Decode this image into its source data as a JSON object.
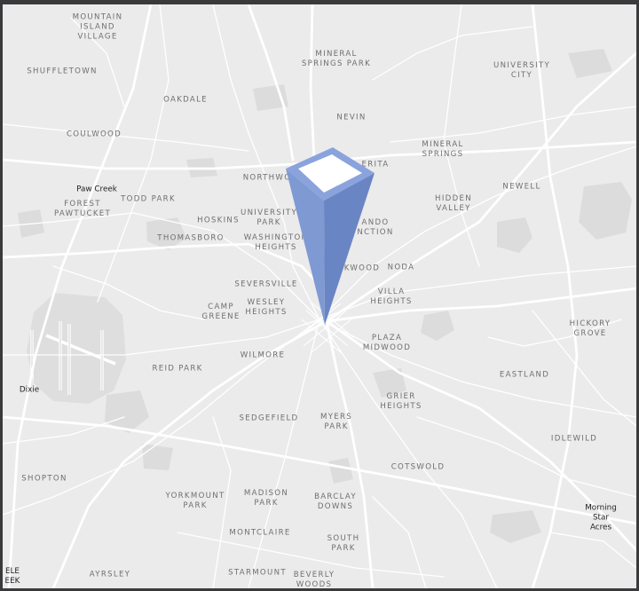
{
  "map": {
    "colors": {
      "land": "#ebebeb",
      "road": "#ffffff",
      "park": "#dcdcdc",
      "marker_side_light": "#7f99d3",
      "marker_side_dark": "#6a85c4",
      "marker_rim": "#8aa3dc",
      "marker_top": "#ffffff",
      "frame": "#3a3a3c"
    },
    "neighborhoods": [
      {
        "id": "mountain-island-village",
        "text": "MOUNTAIN\nISLAND\nVILLAGE"
      },
      {
        "id": "mineral-springs-park",
        "text": "MINERAL\nSPRINGS PARK"
      },
      {
        "id": "university-city",
        "text": "UNIVERSITY\nCITY"
      },
      {
        "id": "shuffletown",
        "text": "SHUFFLETOWN"
      },
      {
        "id": "oakdale",
        "text": "OAKDALE"
      },
      {
        "id": "nevin",
        "text": "NEVIN"
      },
      {
        "id": "coulwood",
        "text": "COULWOOD"
      },
      {
        "id": "mineral-springs",
        "text": "MINERAL\nSPRINGS"
      },
      {
        "id": "northwood",
        "text": "NORTHWO"
      },
      {
        "id": "derita",
        "text": "ERITA"
      },
      {
        "id": "newell",
        "text": "NEWELL"
      },
      {
        "id": "todd-park",
        "text": "TODD PARK"
      },
      {
        "id": "forest-pawtucket",
        "text": "FOREST\nPAWTUCKET"
      },
      {
        "id": "hidden-valley",
        "text": "HIDDEN\nVALLEY"
      },
      {
        "id": "hoskins",
        "text": "HOSKINS"
      },
      {
        "id": "university-park",
        "text": "UNIVERSITY\nPARK"
      },
      {
        "id": "orlando-junction",
        "text": "ANDO\nNCTION"
      },
      {
        "id": "thomasboro",
        "text": "THOMASBORO"
      },
      {
        "id": "washington-heights",
        "text": "WASHINGTON\nHEIGHTS"
      },
      {
        "id": "lockwood",
        "text": "KWOOD"
      },
      {
        "id": "noda",
        "text": "NODA"
      },
      {
        "id": "seversville",
        "text": "SEVERSVILLE"
      },
      {
        "id": "villa-heights",
        "text": "VILLA\nHEIGHTS"
      },
      {
        "id": "camp-greene",
        "text": "CAMP\nGREENE"
      },
      {
        "id": "wesley-heights",
        "text": "WESLEY\nHEIGHTS"
      },
      {
        "id": "hickory-grove",
        "text": "HICKORY\nGROVE"
      },
      {
        "id": "plaza-midwood",
        "text": "PLAZA\nMIDWOOD"
      },
      {
        "id": "wilmore",
        "text": "WILMORE"
      },
      {
        "id": "reid-park",
        "text": "REID PARK"
      },
      {
        "id": "eastland",
        "text": "EASTLAND"
      },
      {
        "id": "grier-heights",
        "text": "GRIER\nHEIGHTS"
      },
      {
        "id": "sedgefield",
        "text": "SEDGEFIELD"
      },
      {
        "id": "myers-park",
        "text": "MYERS\nPARK"
      },
      {
        "id": "idlewild",
        "text": "IDLEWILD"
      },
      {
        "id": "cotswold",
        "text": "COTSWOLD"
      },
      {
        "id": "shopton",
        "text": "SHOPTON"
      },
      {
        "id": "yorkmount-park",
        "text": "YORKMOUNT\nPARK"
      },
      {
        "id": "madison-park",
        "text": "MADISON\nPARK"
      },
      {
        "id": "barclay-downs",
        "text": "BARCLAY\nDOWNS"
      },
      {
        "id": "montclaire",
        "text": "MONTCLAIRE"
      },
      {
        "id": "south-park",
        "text": "SOUTH\nPARK"
      },
      {
        "id": "starmount",
        "text": "STARMOUNT"
      },
      {
        "id": "beverly-woods",
        "text": "BEVERLY\nWOODS"
      },
      {
        "id": "ayrsley",
        "text": "AYRSLEY"
      }
    ],
    "towns": [
      {
        "id": "paw-creek",
        "text": "Paw Creek"
      },
      {
        "id": "dixie",
        "text": "Dixie"
      },
      {
        "id": "morning-star-acres",
        "text": "Morning\nStar Acres"
      },
      {
        "id": "steele-creek",
        "text": "ELE\nEEK"
      }
    ]
  }
}
